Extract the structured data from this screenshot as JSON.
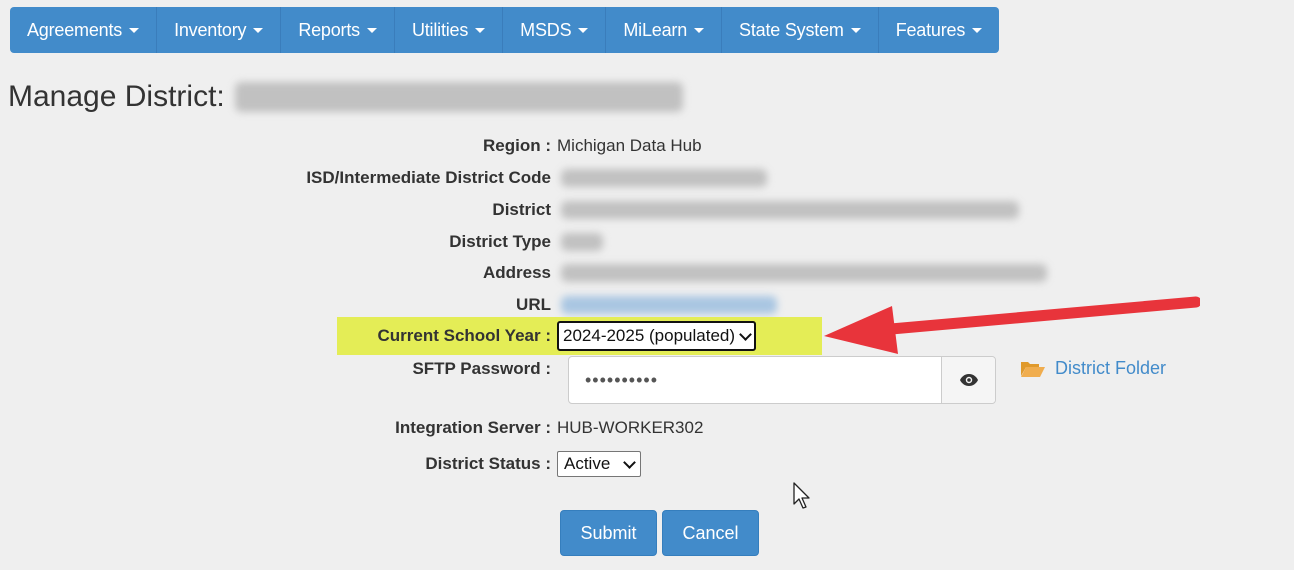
{
  "nav": {
    "items": [
      {
        "label": "Agreements"
      },
      {
        "label": "Inventory"
      },
      {
        "label": "Reports"
      },
      {
        "label": "Utilities"
      },
      {
        "label": "MSDS"
      },
      {
        "label": "MiLearn"
      },
      {
        "label": "State System"
      },
      {
        "label": "Features"
      }
    ]
  },
  "page": {
    "title": "Manage District:"
  },
  "form": {
    "region_label": "Region :",
    "region_value": "Michigan Data Hub",
    "isd_label": "ISD/Intermediate District Code",
    "district_label": "District",
    "district_type_label": "District Type",
    "address_label": "Address",
    "url_label": "URL",
    "school_year_label": "Current School Year :",
    "school_year_value": "2024-2025 (populated)",
    "sftp_label": "SFTP Password :",
    "sftp_value": "••••••••••",
    "folder_link": "District Folder",
    "integration_label": "Integration Server :",
    "integration_value": "HUB-WORKER302",
    "status_label": "District Status :",
    "status_value": "Active",
    "submit_label": "Submit",
    "cancel_label": "Cancel"
  },
  "colors": {
    "nav_blue": "#428bca",
    "highlight": "#e4ed56",
    "arrow_red": "#e8343b",
    "folder": "#f0ad4e"
  },
  "icons": [
    "caret-down-icon",
    "eye-icon",
    "folder-open-icon",
    "red-arrow",
    "mouse-cursor-icon"
  ]
}
